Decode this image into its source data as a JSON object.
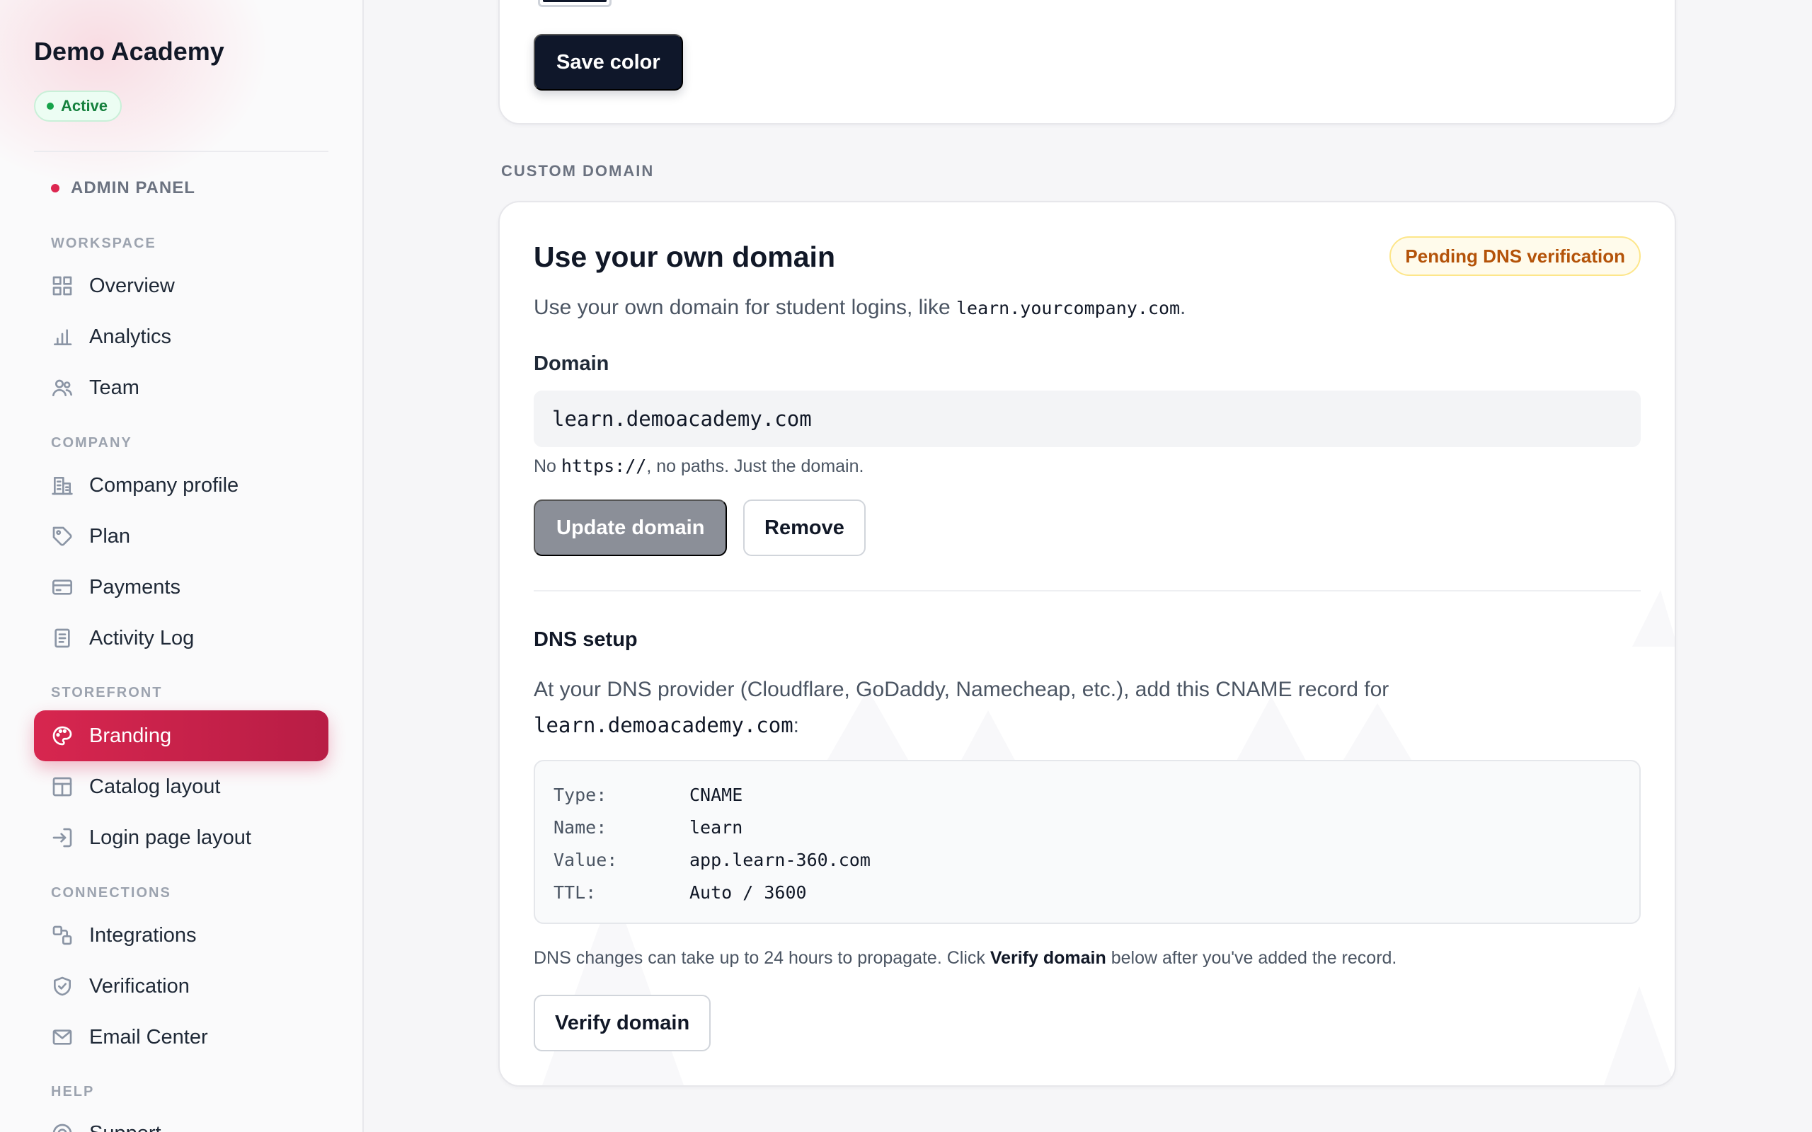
{
  "sidebar": {
    "brand": "Demo Academy",
    "status": "Active",
    "admin_panel": "ADMIN PANEL",
    "groups": {
      "workspace": "WORKSPACE",
      "company": "COMPANY",
      "storefront": "STOREFRONT",
      "connections": "CONNECTIONS",
      "help": "HELP"
    },
    "items": {
      "overview": "Overview",
      "analytics": "Analytics",
      "team": "Team",
      "company_profile": "Company profile",
      "plan": "Plan",
      "payments": "Payments",
      "activity_log": "Activity Log",
      "branding": "Branding",
      "catalog_layout": "Catalog layout",
      "login_page_layout": "Login page layout",
      "integrations": "Integrations",
      "verification": "Verification",
      "email_center": "Email Center",
      "support": "Support"
    },
    "active_item": "Branding",
    "accent_color": "#d7264f"
  },
  "color_card": {
    "save_label": "Save color"
  },
  "custom_domain": {
    "section_label": "CUSTOM DOMAIN",
    "title": "Use your own domain",
    "status_badge": "Pending DNS verification",
    "desc_prefix": "Use your own domain for student logins, like ",
    "desc_example": "learn.yourcompany.com",
    "desc_suffix": ".",
    "field_label": "Domain",
    "domain_value": "learn.demoacademy.com",
    "hint_prefix": "No ",
    "hint_code": "https://",
    "hint_suffix": ", no paths. Just the domain.",
    "update_label": "Update domain",
    "remove_label": "Remove"
  },
  "dns_setup": {
    "title": "DNS setup",
    "desc_text": "At your DNS provider (Cloudflare, GoDaddy, Namecheap, etc.), add this CNAME record for",
    "desc_domain": "learn.demoacademy.com",
    "desc_suffix": ":",
    "records": [
      {
        "key": "Type:",
        "value": "CNAME"
      },
      {
        "key": "Name:",
        "value": "learn"
      },
      {
        "key": "Value:",
        "value": "app.learn-360.com"
      },
      {
        "key": "TTL:",
        "value": "Auto / 3600"
      }
    ],
    "note_prefix": "DNS changes can take up to 24 hours to propagate. Click ",
    "note_bold": "Verify domain",
    "note_suffix": " below after you've added the record.",
    "verify_label": "Verify domain"
  }
}
